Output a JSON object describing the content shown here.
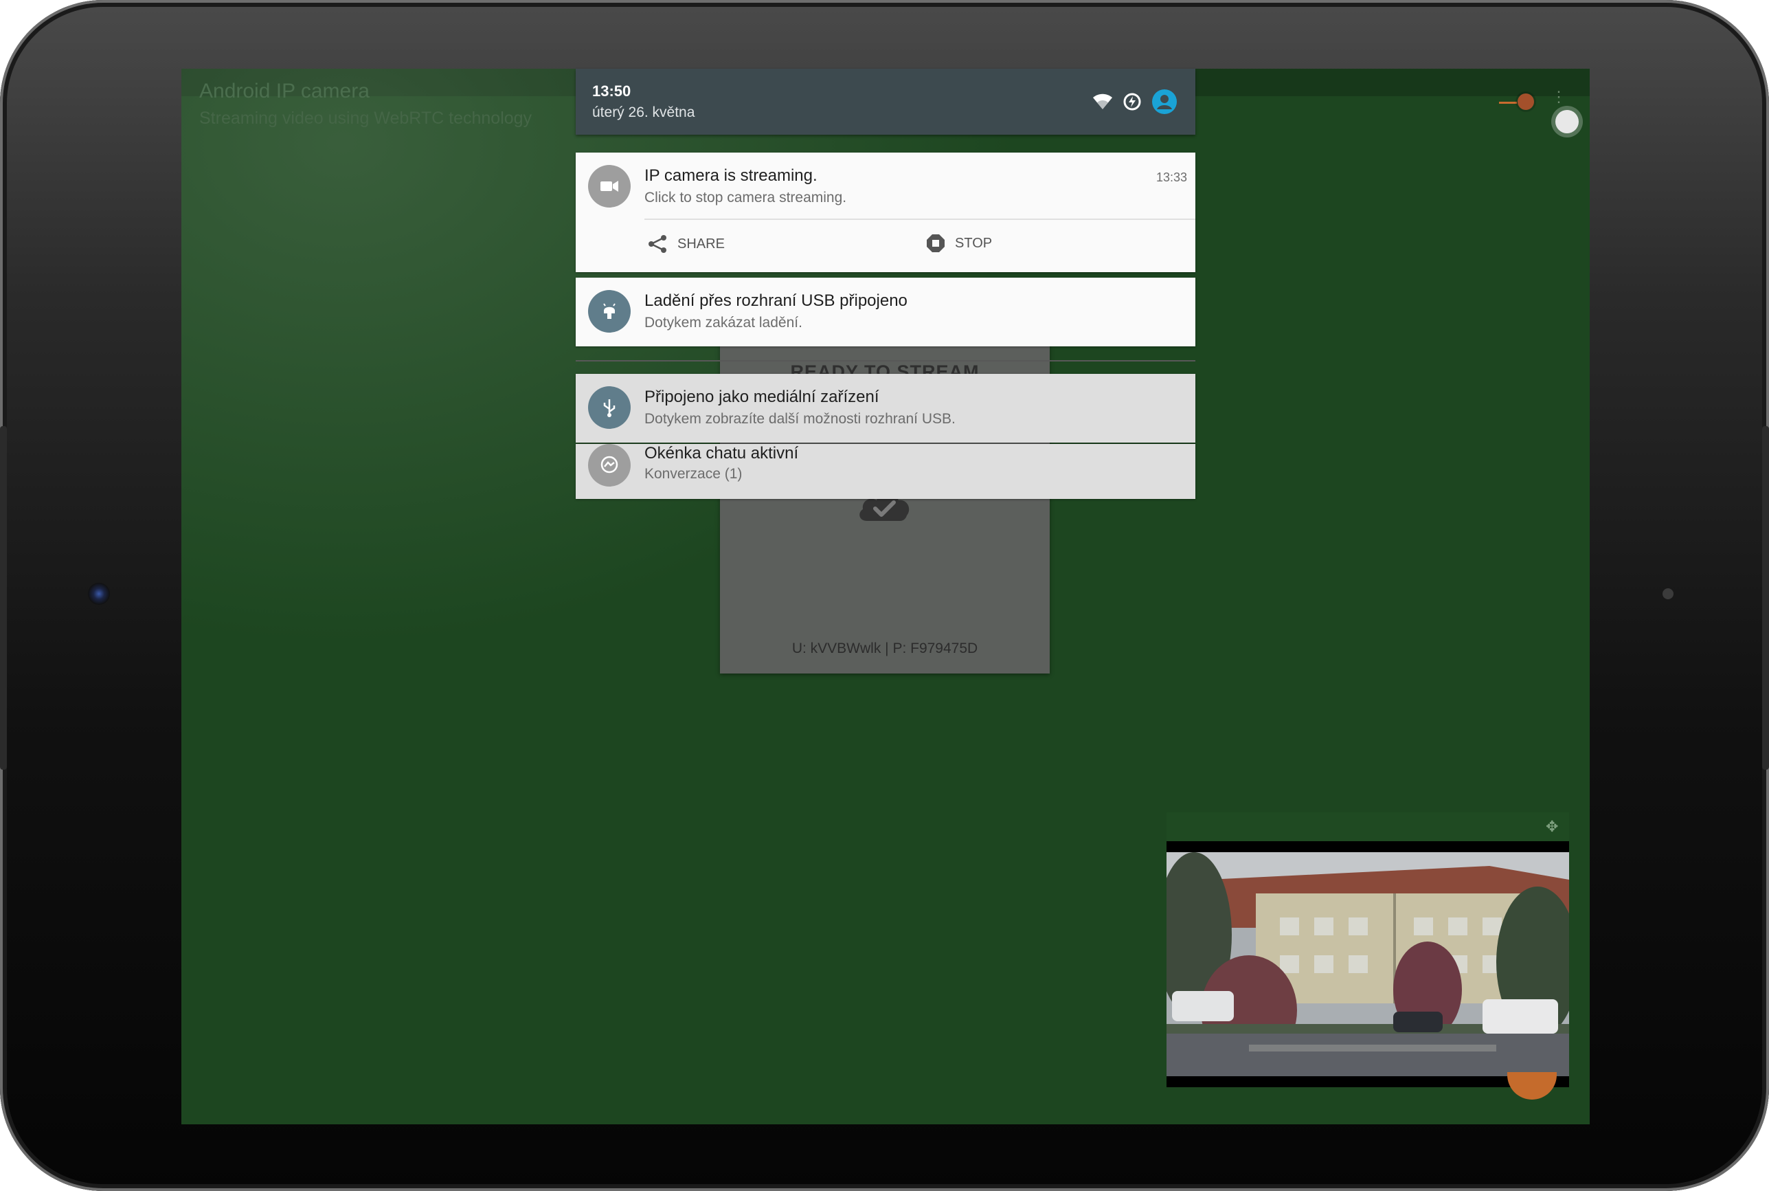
{
  "app": {
    "title": "Android IP camera",
    "subtitle": "Streaming video using WebRTC technology"
  },
  "stream_card": {
    "status": "READY TO STREAM",
    "credentials": "U: kVVBWwlk | P: F979475D"
  },
  "status_bar": {
    "time": "13:50",
    "date": "úterý 26. května",
    "icons": [
      "wifi-icon",
      "data-saver-icon",
      "account-icon"
    ]
  },
  "notifications": [
    {
      "icon": "video-camera-icon",
      "title": "IP camera is streaming.",
      "text": "Click to stop camera streaming.",
      "time": "13:33",
      "actions": [
        {
          "icon": "share-icon",
          "label": "SHARE"
        },
        {
          "icon": "stop-icon",
          "label": "STOP"
        }
      ]
    },
    {
      "icon": "android-debug-icon",
      "title": "Ladění přes rozhraní USB připojeno",
      "text": "Dotykem zakázat ladění."
    },
    {
      "icon": "usb-icon",
      "title": "Připojeno jako mediální zařízení",
      "text": "Dotykem zobrazíte další možnosti rozhraní USB."
    },
    {
      "icon": "messenger-icon",
      "title": "Okénka chatu aktivní",
      "text": "Konverzace (1)"
    }
  ],
  "colors": {
    "app_background": "#1d4620",
    "accent": "#c56b2c",
    "shade_header": "#3d4a4f",
    "account_icon": "#1aa3d6",
    "notif_icon_gray": "#9e9e9e",
    "notif_icon_slate": "#607d8b"
  }
}
